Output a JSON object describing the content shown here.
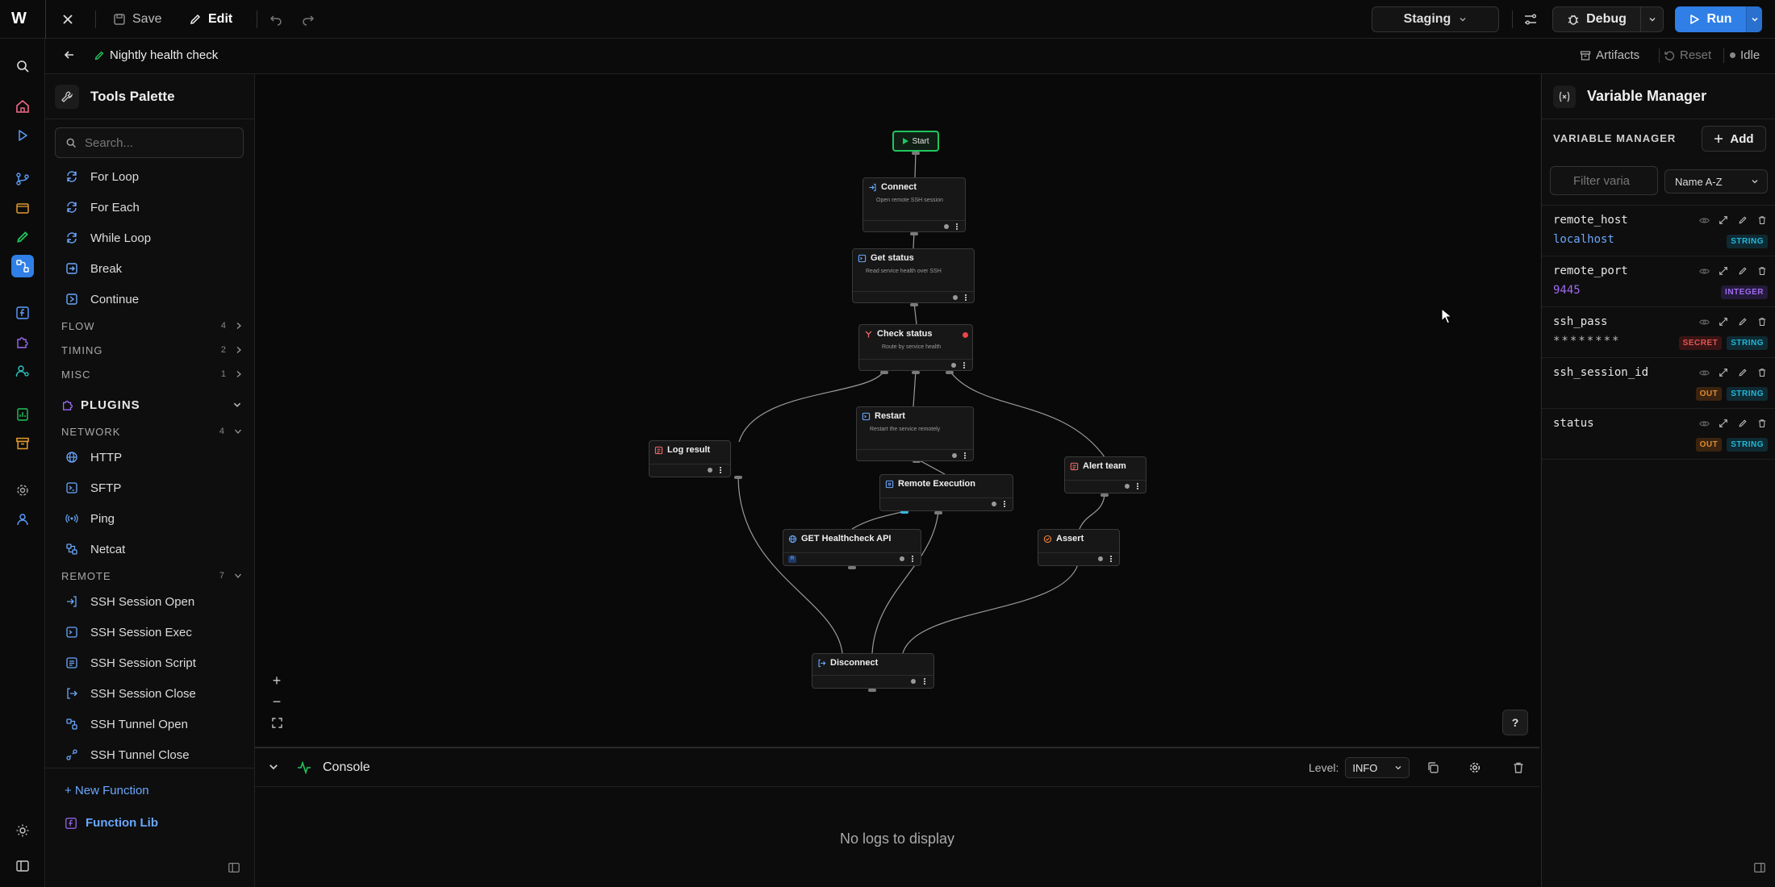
{
  "topbar": {
    "logo": "W",
    "save_label": "Save",
    "edit_label": "Edit",
    "environment": "Staging",
    "debug_label": "Debug",
    "run_label": "Run"
  },
  "subbar": {
    "workflow_name": "Nightly health check",
    "artifacts_label": "Artifacts",
    "reset_label": "Reset",
    "status": "Idle"
  },
  "palette": {
    "title": "Tools Palette",
    "search_placeholder": "Search...",
    "loop_items": [
      "For Loop",
      "For Each",
      "While Loop",
      "Break",
      "Continue"
    ],
    "categories": [
      {
        "name": "FLOW",
        "count": "4"
      },
      {
        "name": "TIMING",
        "count": "2"
      },
      {
        "name": "MISC",
        "count": "1"
      }
    ],
    "plugins_label": "PLUGINS",
    "network": {
      "name": "NETWORK",
      "count": "4",
      "items": [
        "HTTP",
        "SFTP",
        "Ping",
        "Netcat"
      ]
    },
    "remote": {
      "name": "REMOTE",
      "count": "7",
      "items": [
        "SSH Session Open",
        "SSH Session Exec",
        "SSH Session Script",
        "SSH Session Close",
        "SSH Tunnel Open",
        "SSH Tunnel Close"
      ]
    },
    "new_function_label": "+ New Function",
    "function_lib_label": "Function Lib"
  },
  "canvas": {
    "start_label": "Start",
    "nodes": {
      "connect": {
        "title": "Connect",
        "desc": "Open remote SSH session"
      },
      "get_status": {
        "title": "Get status",
        "desc": "Read service health over SSH"
      },
      "check_status": {
        "title": "Check status",
        "desc": "Route by service health"
      },
      "restart": {
        "title": "Restart",
        "desc": "Restart the service remotely"
      },
      "log_result": {
        "title": "Log result"
      },
      "alert_team": {
        "title": "Alert team"
      },
      "remote_exec": {
        "title": "Remote Execution"
      },
      "get_health": {
        "title": "GET Healthcheck API",
        "badge": "R"
      },
      "assert": {
        "title": "Assert"
      },
      "disconnect": {
        "title": "Disconnect"
      }
    },
    "zoom_in": "+",
    "zoom_out": "−",
    "help": "?"
  },
  "console": {
    "title": "Console",
    "level_label": "Level:",
    "level": "INFO",
    "empty_text": "No logs to display"
  },
  "variables": {
    "title": "Variable Manager",
    "section_label": "VARIABLE MANAGER",
    "add_label": "Add",
    "filter_placeholder": "Filter varia",
    "sort": "Name A-Z",
    "items": [
      {
        "name": "remote_host",
        "value": "localhost",
        "tags": [
          "STRING"
        ]
      },
      {
        "name": "remote_port",
        "value": "9445",
        "tags": [
          "INTEGER"
        ]
      },
      {
        "name": "ssh_pass",
        "value": "********",
        "tags": [
          "SECRET",
          "STRING"
        ]
      },
      {
        "name": "ssh_session_id",
        "value": "",
        "tags": [
          "OUT",
          "STRING"
        ]
      },
      {
        "name": "status",
        "value": "",
        "tags": [
          "OUT",
          "STRING"
        ]
      }
    ]
  },
  "colors": {
    "accent": "#2f7fe6",
    "start_green": "#22c55e",
    "string_tag": "#22b8d8",
    "integer_tag": "#a06bf0",
    "secret_tag": "#e05555",
    "out_tag": "#e08a2c",
    "status_red": "#ef4444"
  }
}
